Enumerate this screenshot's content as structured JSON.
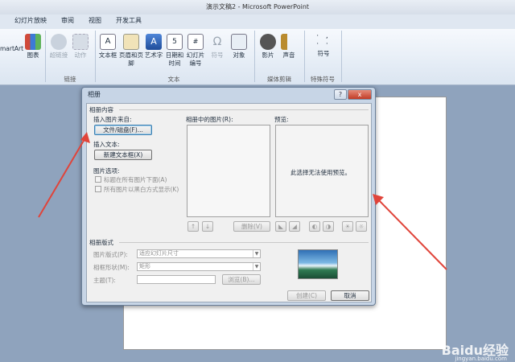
{
  "window": {
    "title": "演示文稿2 - Microsoft PowerPoint"
  },
  "tabs": [
    "幻灯片放映",
    "审阅",
    "视图",
    "开发工具"
  ],
  "ribbon": {
    "left_items": [
      "martArt",
      "图表"
    ],
    "link_group": {
      "items": [
        "超链接",
        "动作"
      ],
      "label": "链接"
    },
    "text_group": {
      "items": [
        "文本框",
        "页眉和页脚",
        "艺术字",
        "日期和时间",
        "幻灯片编号",
        "符号",
        "对象"
      ],
      "label": "文本"
    },
    "media_group": {
      "items": [
        "影片",
        "声音"
      ],
      "label": "媒体剪辑"
    },
    "symbol_group": {
      "items": [
        "符号"
      ],
      "label": "特殊符号"
    }
  },
  "dialog": {
    "title": "相册",
    "help": "?",
    "close": "x",
    "album_content_label": "相册内容",
    "insert_picture_from": "插入图片来自:",
    "file_disk_button": "文件/磁盘(F)...",
    "insert_text": "插入文本:",
    "new_textbox_button": "新建文本框(X)",
    "picture_options": "图片选项:",
    "caption_option": "标题在所有图片下面(A)",
    "bw_option": "所有图片以黑白方式显示(K)",
    "pictures_in_album": "相册中的图片(R):",
    "preview_label": "预览:",
    "preview_message": "此选择无法使用预览。",
    "move_up": "↑",
    "move_down": "↓",
    "delete_button": "删除(V)",
    "layout_section": "相册版式",
    "picture_layout_label": "图片版式(P):",
    "picture_layout_value": "适应幻灯片尺寸",
    "frame_shape_label": "相框形状(M):",
    "frame_shape_value": "矩形",
    "theme_label": "主题(T):",
    "browse_button": "浏览(B)...",
    "create_button": "创建(C)",
    "cancel_button": "取消"
  },
  "watermark": {
    "brand": "Baidu经验",
    "url": "jingyan.baidu.com"
  },
  "colors": {
    "arrow": "#e0443a",
    "close": "#c13b26"
  }
}
